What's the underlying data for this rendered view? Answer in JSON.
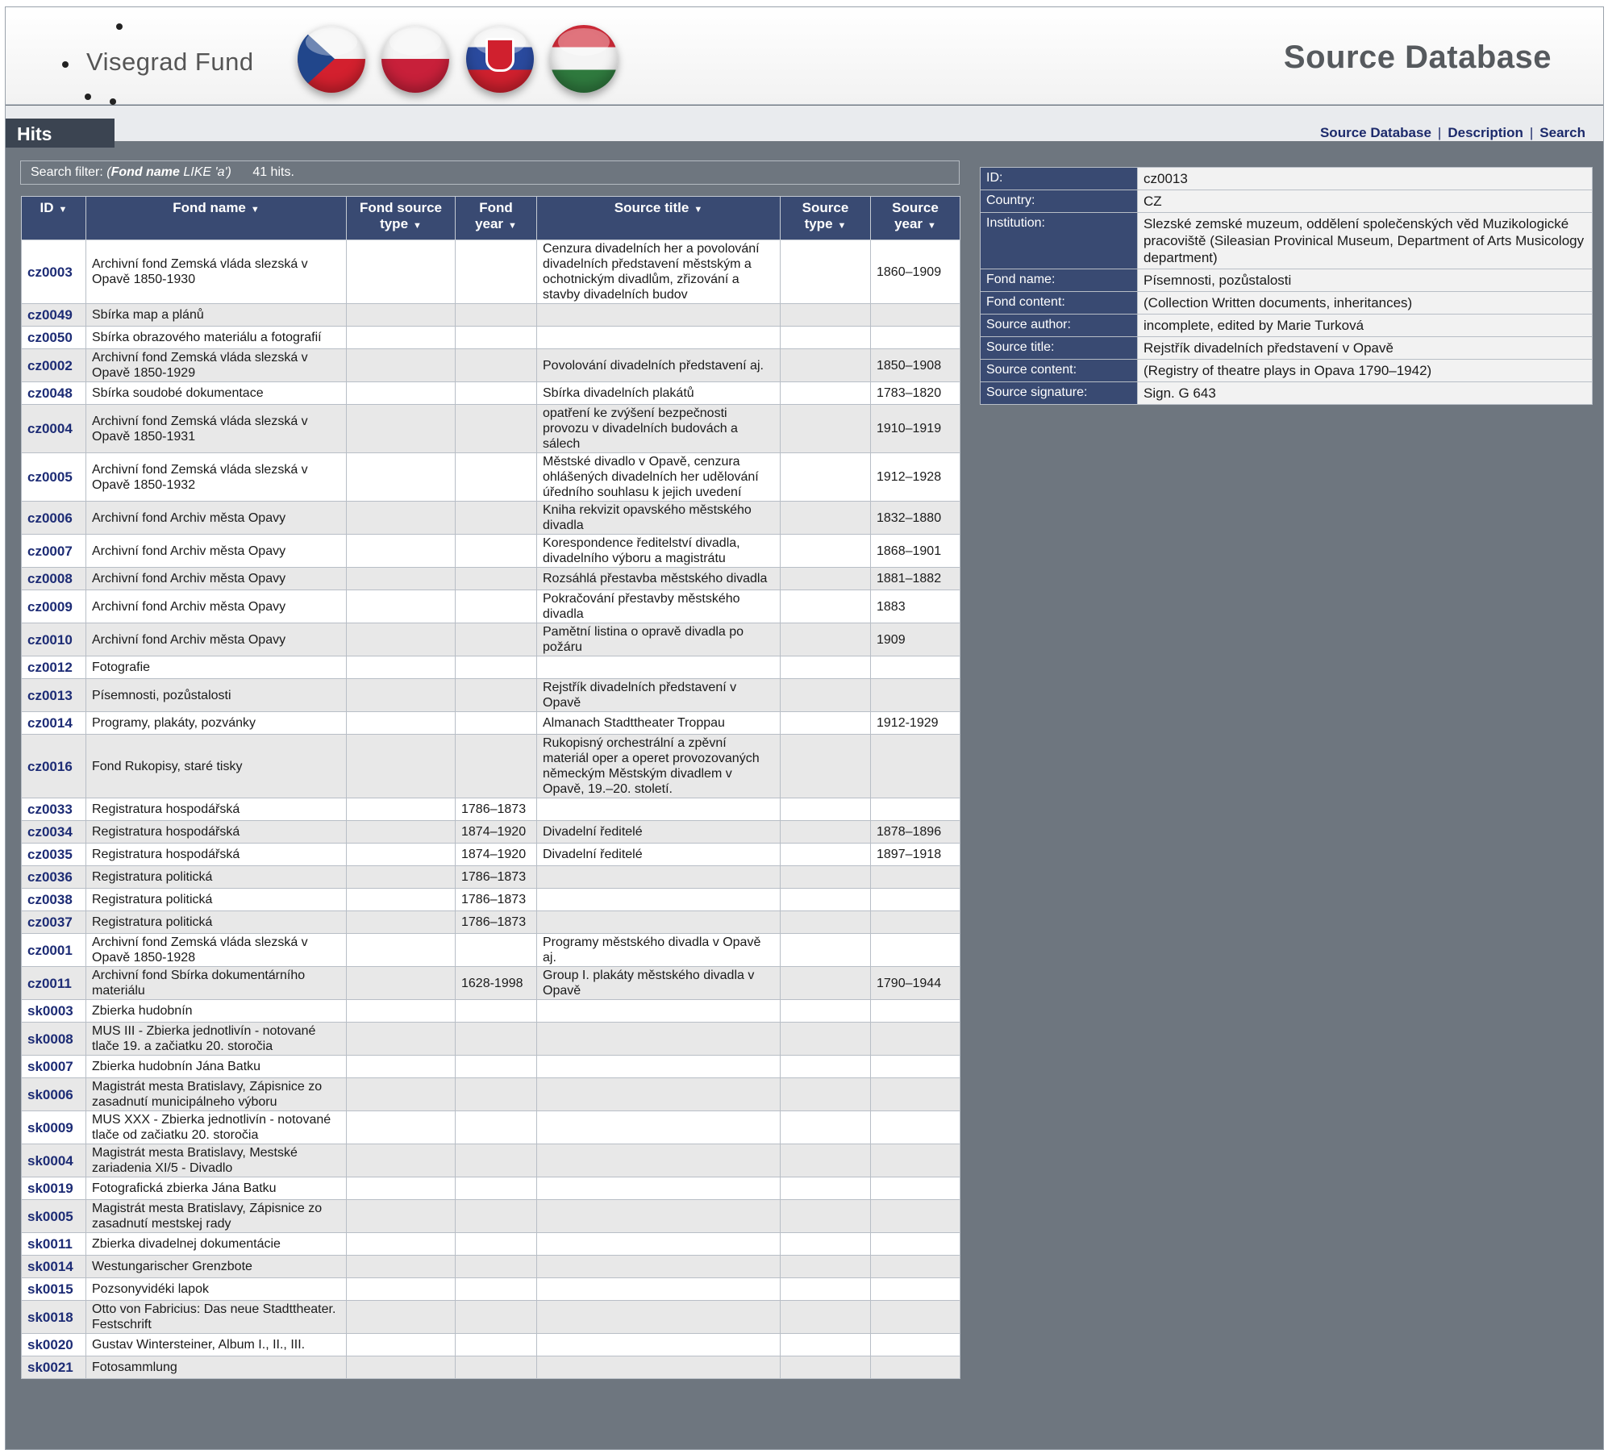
{
  "header": {
    "logo_text": "Visegrad Fund",
    "site_title": "Source Database",
    "flags": [
      "czech-flag-icon",
      "polish-flag-icon",
      "slovak-flag-icon",
      "hungarian-flag-icon"
    ]
  },
  "tabbar": {
    "hits_label": "Hits",
    "nav": [
      "Source Database",
      "Description",
      "Search"
    ]
  },
  "filter": {
    "label": "Search filter: ",
    "field": "Fond name",
    "op_value": " LIKE 'a')",
    "open_paren": "(",
    "count": "41 hits."
  },
  "columns": [
    {
      "line1": "ID",
      "line2": ""
    },
    {
      "line1": "Fond name",
      "line2": ""
    },
    {
      "line1": "Fond source",
      "line2": "type"
    },
    {
      "line1": "Fond",
      "line2": "year"
    },
    {
      "line1": "Source title",
      "line2": ""
    },
    {
      "line1": "Source",
      "line2": "type"
    },
    {
      "line1": "Source",
      "line2": "year"
    }
  ],
  "rows": [
    {
      "id": "cz0003",
      "fond_name": "Archivní fond Zemská vláda slezská v Opavě 1850-1930",
      "fond_source_type": "",
      "fond_year": "",
      "source_title": "Cenzura divadelních her a povolování divadelních představení městským a ochotnickým divadlům, zřizování a stavby divadelních budov",
      "source_type": "",
      "source_year": "1860–1909"
    },
    {
      "id": "cz0049",
      "fond_name": "Sbírka map a plánů",
      "fond_source_type": "",
      "fond_year": "",
      "source_title": "",
      "source_type": "",
      "source_year": ""
    },
    {
      "id": "cz0050",
      "fond_name": "Sbírka obrazového materiálu a fotografií",
      "fond_source_type": "",
      "fond_year": "",
      "source_title": "",
      "source_type": "",
      "source_year": ""
    },
    {
      "id": "cz0002",
      "fond_name": "Archivní fond Zemská vláda slezská v Opavě 1850-1929",
      "fond_source_type": "",
      "fond_year": "",
      "source_title": "Povolování divadelních představení aj.",
      "source_type": "",
      "source_year": "1850–1908"
    },
    {
      "id": "cz0048",
      "fond_name": "Sbírka soudobé dokumentace",
      "fond_source_type": "",
      "fond_year": "",
      "source_title": "Sbírka divadelních plakátů",
      "source_type": "",
      "source_year": "1783–1820"
    },
    {
      "id": "cz0004",
      "fond_name": "Archivní fond Zemská vláda slezská v Opavě 1850-1931",
      "fond_source_type": "",
      "fond_year": "",
      "source_title": "opatření ke zvýšení bezpečnosti provozu v divadelních budovách a sálech",
      "source_type": "",
      "source_year": "1910–1919"
    },
    {
      "id": "cz0005",
      "fond_name": "Archivní fond Zemská vláda slezská v Opavě 1850-1932",
      "fond_source_type": "",
      "fond_year": "",
      "source_title": "Městské divadlo v Opavě, cenzura ohlášených divadelních her udělování úředního souhlasu k jejich uvedení",
      "source_type": "",
      "source_year": "1912–1928"
    },
    {
      "id": "cz0006",
      "fond_name": "Archivní fond Archiv města Opavy",
      "fond_source_type": "",
      "fond_year": "",
      "source_title": "Kniha rekvizit opavského městského divadla",
      "source_type": "",
      "source_year": "1832–1880"
    },
    {
      "id": "cz0007",
      "fond_name": "Archivní fond Archiv města Opavy",
      "fond_source_type": "",
      "fond_year": "",
      "source_title": "Korespondence ředitelství divadla, divadelního výboru a magistrátu",
      "source_type": "",
      "source_year": "1868–1901"
    },
    {
      "id": "cz0008",
      "fond_name": "Archivní fond Archiv města Opavy",
      "fond_source_type": "",
      "fond_year": "",
      "source_title": "Rozsáhlá přestavba městského divadla",
      "source_type": "",
      "source_year": "1881–1882"
    },
    {
      "id": "cz0009",
      "fond_name": "Archivní fond Archiv města Opavy",
      "fond_source_type": "",
      "fond_year": "",
      "source_title": "Pokračování přestavby městského divadla",
      "source_type": "",
      "source_year": "1883"
    },
    {
      "id": "cz0010",
      "fond_name": "Archivní fond Archiv města Opavy",
      "fond_source_type": "",
      "fond_year": "",
      "source_title": "Pamětní listina o opravě divadla po požáru",
      "source_type": "",
      "source_year": "1909"
    },
    {
      "id": "cz0012",
      "fond_name": "Fotografie",
      "fond_source_type": "",
      "fond_year": "",
      "source_title": "",
      "source_type": "",
      "source_year": ""
    },
    {
      "id": "cz0013",
      "fond_name": "Písemnosti, pozůstalosti",
      "fond_source_type": "",
      "fond_year": "",
      "source_title": "Rejstřík divadelních představení v Opavě",
      "source_type": "",
      "source_year": ""
    },
    {
      "id": "cz0014",
      "fond_name": "Programy, plakáty, pozvánky",
      "fond_source_type": "",
      "fond_year": "",
      "source_title": "Almanach Stadttheater Troppau",
      "source_type": "",
      "source_year": "1912-1929"
    },
    {
      "id": "cz0016",
      "fond_name": "Fond Rukopisy, staré tisky",
      "fond_source_type": "",
      "fond_year": "",
      "source_title": "Rukopisný orchestrální a zpěvní materiál oper a operet provozovaných německým Městským divadlem v Opavě, 19.–20. století.",
      "source_type": "",
      "source_year": ""
    },
    {
      "id": "cz0033",
      "fond_name": "Registratura hospodářská",
      "fond_source_type": "",
      "fond_year": "1786–1873",
      "source_title": "",
      "source_type": "",
      "source_year": ""
    },
    {
      "id": "cz0034",
      "fond_name": "Registratura hospodářská",
      "fond_source_type": "",
      "fond_year": "1874–1920",
      "source_title": "Divadelní ředitelé",
      "source_type": "",
      "source_year": "1878–1896"
    },
    {
      "id": "cz0035",
      "fond_name": "Registratura hospodářská",
      "fond_source_type": "",
      "fond_year": "1874–1920",
      "source_title": "Divadelní ředitelé",
      "source_type": "",
      "source_year": "1897–1918"
    },
    {
      "id": "cz0036",
      "fond_name": "Registratura politická",
      "fond_source_type": "",
      "fond_year": "1786–1873",
      "source_title": "",
      "source_type": "",
      "source_year": ""
    },
    {
      "id": "cz0038",
      "fond_name": "Registratura politická",
      "fond_source_type": "",
      "fond_year": "1786–1873",
      "source_title": "",
      "source_type": "",
      "source_year": ""
    },
    {
      "id": "cz0037",
      "fond_name": "Registratura politická",
      "fond_source_type": "",
      "fond_year": "1786–1873",
      "source_title": "",
      "source_type": "",
      "source_year": ""
    },
    {
      "id": "cz0001",
      "fond_name": "Archivní fond Zemská vláda slezská v Opavě 1850-1928",
      "fond_source_type": "",
      "fond_year": "",
      "source_title": "Programy městského divadla v Opavě aj.",
      "source_type": "",
      "source_year": ""
    },
    {
      "id": "cz0011",
      "fond_name": "Archivní fond Sbírka dokumentárního materiálu",
      "fond_source_type": "",
      "fond_year": "1628-1998",
      "source_title": "Group I. plakáty městského divadla v Opavě",
      "source_type": "",
      "source_year": "1790–1944"
    },
    {
      "id": "sk0003",
      "fond_name": "Zbierka hudobnín",
      "fond_source_type": "",
      "fond_year": "",
      "source_title": "",
      "source_type": "",
      "source_year": ""
    },
    {
      "id": "sk0008",
      "fond_name": "MUS III - Zbierka jednotlivín - notované tlače 19. a začiatku 20. storočia",
      "fond_source_type": "",
      "fond_year": "",
      "source_title": "",
      "source_type": "",
      "source_year": ""
    },
    {
      "id": "sk0007",
      "fond_name": "Zbierka hudobnín Jána Batku",
      "fond_source_type": "",
      "fond_year": "",
      "source_title": "",
      "source_type": "",
      "source_year": ""
    },
    {
      "id": "sk0006",
      "fond_name": "Magistrát mesta Bratislavy, Zápisnice zo zasadnutí municipálneho výboru",
      "fond_source_type": "",
      "fond_year": "",
      "source_title": "",
      "source_type": "",
      "source_year": ""
    },
    {
      "id": "sk0009",
      "fond_name": "MUS XXX - Zbierka jednotlivín - notované tlače od začiatku 20. storočia",
      "fond_source_type": "",
      "fond_year": "",
      "source_title": "",
      "source_type": "",
      "source_year": ""
    },
    {
      "id": "sk0004",
      "fond_name": "Magistrát mesta Bratislavy, Mestské zariadenia XI/5 - Divadlo",
      "fond_source_type": "",
      "fond_year": "",
      "source_title": "",
      "source_type": "",
      "source_year": ""
    },
    {
      "id": "sk0019",
      "fond_name": "Fotografická zbierka Jána Batku",
      "fond_source_type": "",
      "fond_year": "",
      "source_title": "",
      "source_type": "",
      "source_year": ""
    },
    {
      "id": "sk0005",
      "fond_name": "Magistrát mesta Bratislavy, Zápisnice zo zasadnutí mestskej rady",
      "fond_source_type": "",
      "fond_year": "",
      "source_title": "",
      "source_type": "",
      "source_year": ""
    },
    {
      "id": "sk0011",
      "fond_name": "Zbierka divadelnej dokumentácie",
      "fond_source_type": "",
      "fond_year": "",
      "source_title": "",
      "source_type": "",
      "source_year": ""
    },
    {
      "id": "sk0014",
      "fond_name": "Westungarischer Grenzbote",
      "fond_source_type": "",
      "fond_year": "",
      "source_title": "",
      "source_type": "",
      "source_year": ""
    },
    {
      "id": "sk0015",
      "fond_name": "Pozsonyvidéki lapok",
      "fond_source_type": "",
      "fond_year": "",
      "source_title": "",
      "source_type": "",
      "source_year": ""
    },
    {
      "id": "sk0018",
      "fond_name": "Otto von Fabricius: Das neue Stadttheater. Festschrift",
      "fond_source_type": "",
      "fond_year": "",
      "source_title": "",
      "source_type": "",
      "source_year": ""
    },
    {
      "id": "sk0020",
      "fond_name": "Gustav Wintersteiner, Album I., II., III.",
      "fond_source_type": "",
      "fond_year": "",
      "source_title": "",
      "source_type": "",
      "source_year": ""
    },
    {
      "id": "sk0021",
      "fond_name": "Fotosammlung",
      "fond_source_type": "",
      "fond_year": "",
      "source_title": "",
      "source_type": "",
      "source_year": ""
    }
  ],
  "detail": [
    {
      "label": "ID:",
      "value": "cz0013"
    },
    {
      "label": "Country:",
      "value": "CZ"
    },
    {
      "label": "Institution:",
      "value": "Slezské zemské muzeum, oddělení společenských věd Muzikologické pracoviště (Sileasian Provinical Museum, Department of Arts Musicology department)"
    },
    {
      "label": "Fond name:",
      "value": "Písemnosti, pozůstalosti"
    },
    {
      "label": "Fond content:",
      "value": "(Collection Written documents, inheritances)"
    },
    {
      "label": "Source author:",
      "value": "incomplete, edited by Marie Turková"
    },
    {
      "label": "Source title:",
      "value": "Rejstřík divadelních představení v Opavě"
    },
    {
      "label": "Source content:",
      "value": "(Registry of theatre plays in Opava 1790–1942)"
    },
    {
      "label": "Source signature:",
      "value": "Sign. G 643"
    }
  ]
}
